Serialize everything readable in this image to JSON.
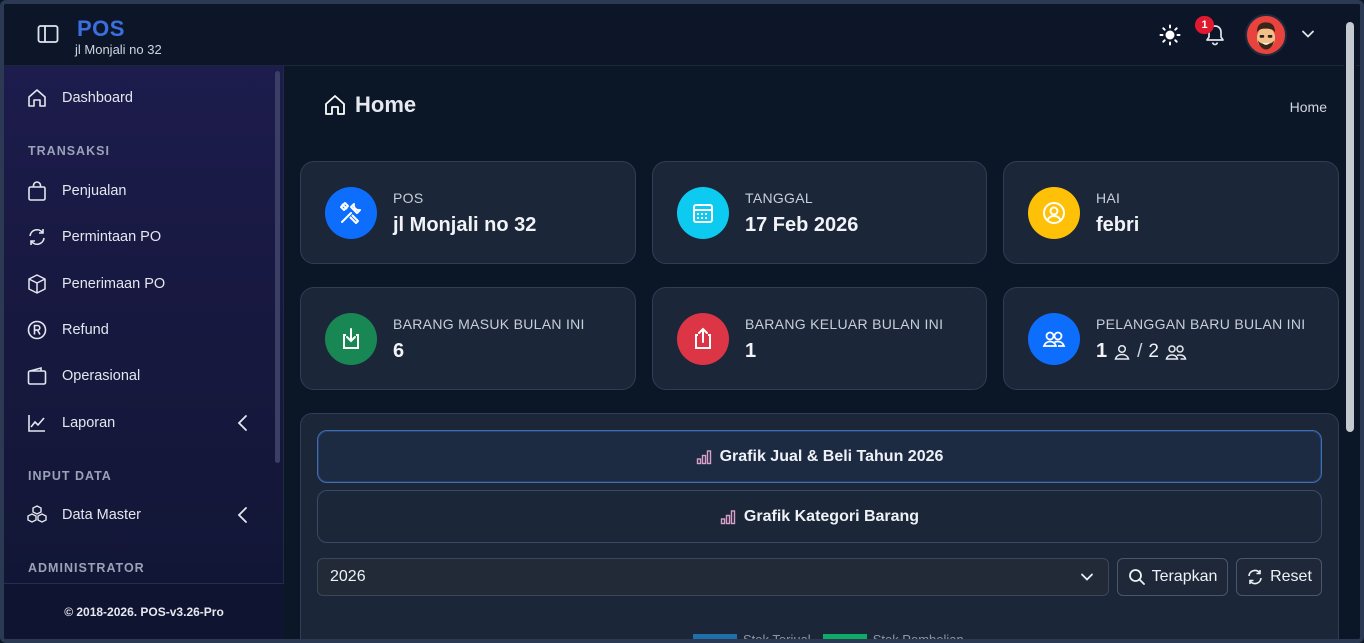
{
  "brand": {
    "title": "POS",
    "subtitle": "jl Monjali no 32"
  },
  "topbar": {
    "notification_count": "1"
  },
  "sidebar": {
    "items": [
      {
        "label": "Dashboard"
      },
      {
        "label": "Penjualan"
      },
      {
        "label": "Permintaan PO"
      },
      {
        "label": "Penerimaan PO"
      },
      {
        "label": "Refund"
      },
      {
        "label": "Operasional"
      },
      {
        "label": "Laporan"
      },
      {
        "label": "Data Master"
      }
    ],
    "headings": [
      "TRANSAKSI",
      "INPUT DATA",
      "ADMINISTRATOR"
    ],
    "footer": "© 2018-2026. POS-v3.26-Pro"
  },
  "page": {
    "title": "Home",
    "breadcrumb": "Home"
  },
  "cards": [
    {
      "label": "POS",
      "value": "jl Monjali no 32",
      "color": "#0d6efd"
    },
    {
      "label": "TANGGAL",
      "value": "17 Feb 2026",
      "color": "#0dcaf0"
    },
    {
      "label": "HAI",
      "value": "febri",
      "color": "#ffc107"
    },
    {
      "label": "BARANG MASUK BULAN INI",
      "value": "6",
      "color": "#198754"
    },
    {
      "label": "BARANG KELUAR BULAN INI",
      "value": "1",
      "color": "#dc3545"
    },
    {
      "label": "PELANGGAN BARU BULAN INI",
      "value_a": "1",
      "value_sep": "/",
      "value_b": "2",
      "color": "#0d6efd"
    }
  ],
  "chart_panel": {
    "accordion": [
      "Grafik Jual & Beli Tahun 2026",
      "Grafik Kategori Barang"
    ],
    "year_select": "2026",
    "apply_label": "Terapkan",
    "reset_label": "Reset",
    "legend": [
      {
        "name": "Stok Terjual",
        "color": "#1f6fa8"
      },
      {
        "name": "Stok Pembelian",
        "color": "#0fa968"
      }
    ]
  }
}
